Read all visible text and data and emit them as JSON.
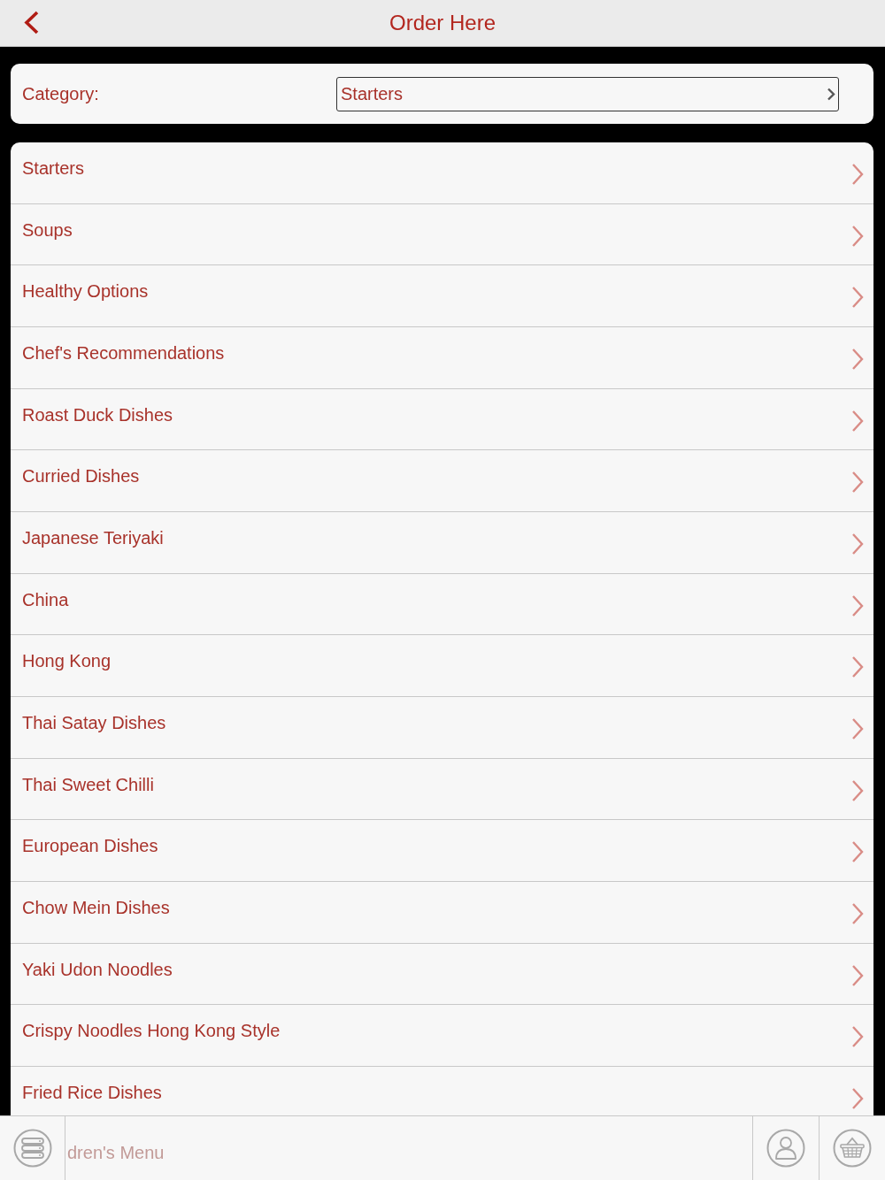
{
  "header": {
    "title": "Order Here"
  },
  "category_picker": {
    "label": "Category:",
    "value": "Starters"
  },
  "categories": [
    "Starters",
    "Soups",
    "Healthy Options",
    "Chef's Recommendations",
    "Roast Duck Dishes",
    "Curried Dishes",
    "Japanese Teriyaki",
    "China",
    "Hong Kong",
    "Thai Satay Dishes",
    "Thai Sweet Chilli",
    "European Dishes",
    "Chow Mein Dishes",
    "Yaki Udon Noodles",
    "Crispy Noodles Hong Kong Style",
    "Fried Rice Dishes"
  ],
  "tab_bar": {
    "covered_row_label": "dren's Menu"
  }
}
